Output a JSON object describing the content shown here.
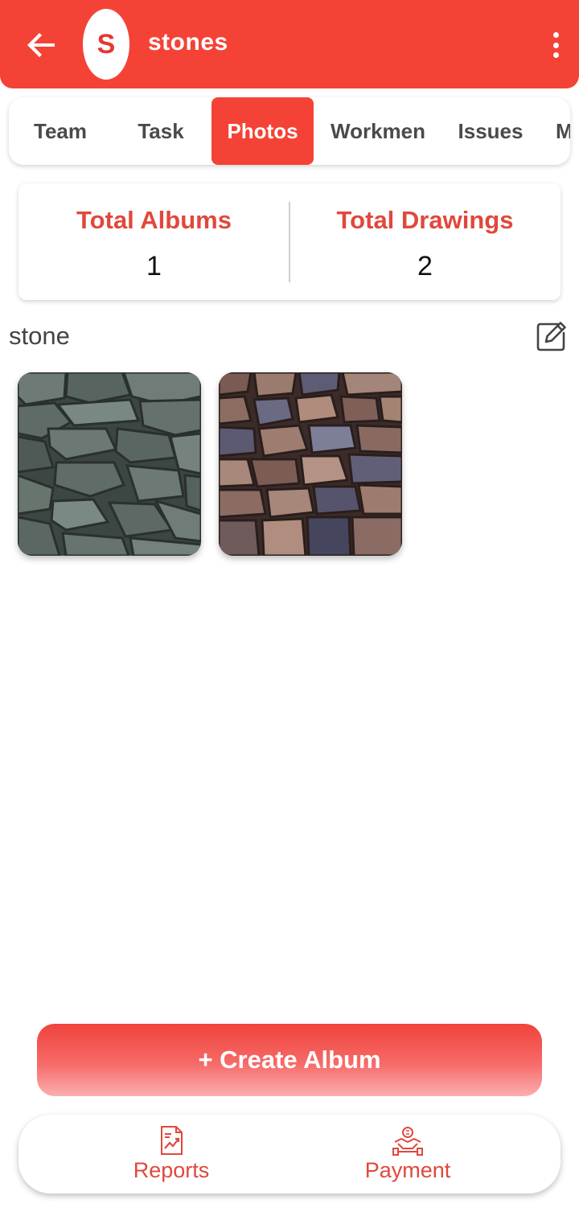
{
  "header": {
    "avatar_letter": "S",
    "title": "stones",
    "back_icon": "arrow-left-icon",
    "menu_icon": "more-vert-icon",
    "color": "#f44336"
  },
  "tabs": [
    {
      "label": "Team",
      "active": false
    },
    {
      "label": "Task",
      "active": false
    },
    {
      "label": "Photos",
      "active": true
    },
    {
      "label": "Workmen",
      "active": false
    },
    {
      "label": "Issues",
      "active": false
    },
    {
      "label": "M",
      "active": false
    }
  ],
  "stats": {
    "albums_label": "Total Albums",
    "albums_value": "1",
    "drawings_label": "Total Drawings",
    "drawings_value": "2"
  },
  "album": {
    "title": "stone",
    "edit_icon": "edit-icon",
    "photos": [
      {
        "name": "grey stone wall",
        "icon": "photo-thumbnail"
      },
      {
        "name": "brown and blue stone wall",
        "icon": "photo-thumbnail"
      }
    ]
  },
  "actions": {
    "create_album": "+ Create Album"
  },
  "bottom_nav": [
    {
      "label": "Reports",
      "icon": "report-chart-icon"
    },
    {
      "label": "Payment",
      "icon": "handshake-payment-icon"
    }
  ],
  "colors": {
    "accent": "#f44336",
    "label_red": "#e0483c"
  }
}
